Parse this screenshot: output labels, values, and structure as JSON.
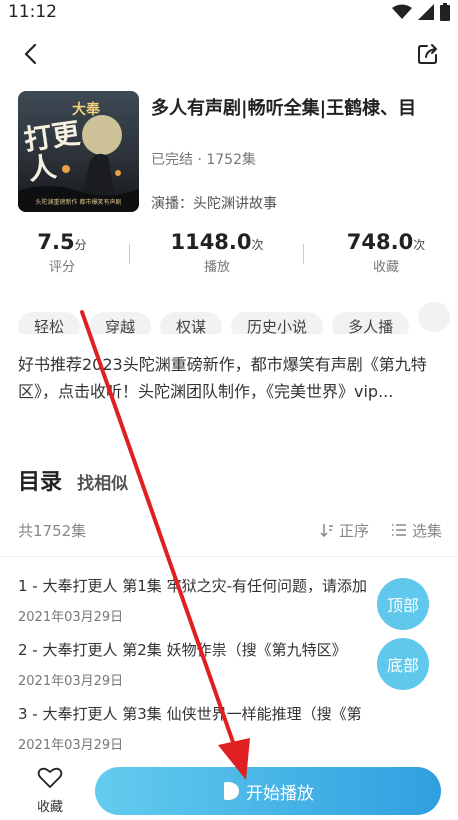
{
  "status_bar": {
    "time": "11:12"
  },
  "book": {
    "title": "多人有声剧|畅听全集|王鹤棣、目",
    "status": "已完结 · 1752集",
    "narrator": "演播：头陀渊讲故事",
    "cover_text_top": "大奉",
    "cover_text_main": "打更人",
    "cover_text_bottom": "头陀渊重磅新作  都市爆笑有声剧"
  },
  "stats": [
    {
      "value": "7.5",
      "unit": "分",
      "label": "评分"
    },
    {
      "value": "1148.0",
      "unit": "次",
      "label": "播放"
    },
    {
      "value": "748.0",
      "unit": "次",
      "label": "收藏"
    }
  ],
  "tags": [
    "轻松",
    "穿越",
    "权谋",
    "历史小说",
    "多人播"
  ],
  "description": "好书推荐2023头陀渊重磅新作，都市爆笑有声剧《第九特区》，点击收听！头陀渊团队制作，《完美世界》vip...",
  "section": {
    "title": "目录",
    "subtitle": "找相似"
  },
  "episode_list": {
    "total": "共1752集",
    "sort_label": "正序",
    "select_label": "选集"
  },
  "episodes": [
    {
      "title": "1 - 大奉打更人 第1集 牢狱之灾-有任何问题，请添加",
      "date": "2021年03月29日"
    },
    {
      "title": "2 - 大奉打更人 第2集 妖物作祟（搜《第九特区》",
      "date": "2021年03月29日"
    },
    {
      "title": "3 - 大奉打更人 第3集 仙侠世界一样能推理（搜《第",
      "date": "2021年03月29日"
    }
  ],
  "float_buttons": {
    "top": "顶部",
    "bottom": "底部"
  },
  "bottom_bar": {
    "favorite_label": "收藏",
    "play_label": "开始播放"
  },
  "colors": {
    "accent": "#5fc8ec",
    "play_gradient_start": "#63ccee",
    "play_gradient_end": "#2f9fe0",
    "arrow": "#e02020"
  }
}
